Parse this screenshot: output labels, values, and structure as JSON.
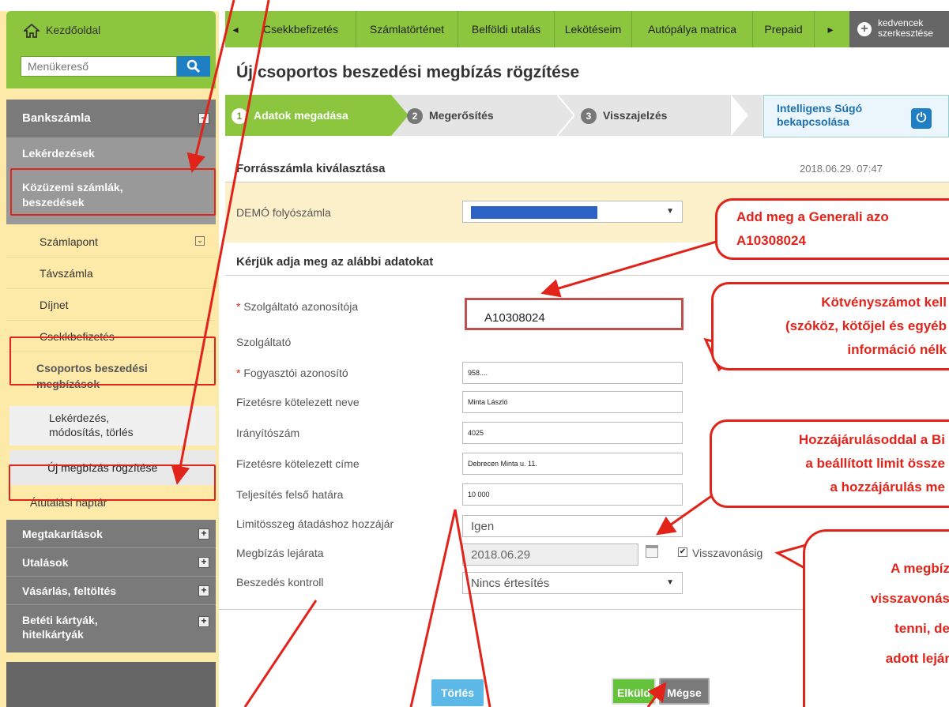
{
  "sidebar": {
    "home_label": "Kezdőoldal",
    "search_placeholder": "Menükereső",
    "account_section": "Bankszámla",
    "items": [
      {
        "label": "Lekérdezések"
      },
      {
        "label": "Közüzemi számlák, beszedések"
      },
      {
        "label": "Számlapont"
      },
      {
        "label": "Távszámla"
      },
      {
        "label": "Díjnet"
      },
      {
        "label": "Csekkbefizetés"
      },
      {
        "label": "Csoportos beszedési megbízások"
      },
      {
        "label": "Lekérdezés, módosítás, törlés"
      },
      {
        "label": "Új megbízás rögzítése"
      },
      {
        "label": "Átutalási naptár"
      }
    ],
    "sections": [
      {
        "label": "Megtakarítások"
      },
      {
        "label": "Utalások"
      },
      {
        "label": "Vásárlás, feltöltés"
      },
      {
        "label": "Betéti kártyák, hitelkártyák"
      }
    ]
  },
  "topnav": {
    "items": [
      "Csekkbefizetés",
      "Számlatörténet",
      "Belföldi utalás",
      "Lekötéseim",
      "Autópálya matrica",
      "Prepaid"
    ],
    "favorites_label_1": "kedvencek",
    "favorites_label_2": "szerkesztése"
  },
  "page_title": "Új csoportos beszedési megbízás rögzítése",
  "steps": [
    {
      "num": "1",
      "label": "Adatok megadása"
    },
    {
      "num": "2",
      "label": "Megerősítés"
    },
    {
      "num": "3",
      "label": "Visszajelzés"
    }
  ],
  "help": {
    "line1": "Intelligens Súgó",
    "line2": "bekapcsolása"
  },
  "source_section": {
    "title": "Forrásszámla kiválasztása",
    "date": "2018.06.29. 07:47",
    "account_label": "DEMÓ folyószámla"
  },
  "form": {
    "section_title": "Kérjük adja meg az alábbi adatokat",
    "provider_id_label": "Szolgáltató azonosítója",
    "provider_id_value": "A10308024",
    "provider_label": "Szolgáltató",
    "consumer_id_label": "Fogyasztói azonosító",
    "consumer_id_value": "958....",
    "payer_name_label": "Fizetésre kötelezett neve",
    "payer_name_value": "Minta László",
    "zip_label": "Irányítószám",
    "zip_value": "4025",
    "payer_address_label": "Fizetésre kötelezett címe",
    "payer_address_value": "Debrecen Minta u. 11.",
    "limit_label": "Teljesítés felső határa",
    "limit_value": "10 000",
    "limit_consent_label": "Limitösszeg átadáshoz hozzájár",
    "limit_consent_value": "Igen",
    "expiry_label": "Megbízás lejárata",
    "expiry_value": "2018.06.29",
    "until_revoked_label": "Visszavonásig",
    "control_label": "Beszedés kontroll",
    "control_value": "Nincs értesítés"
  },
  "buttons": {
    "delete": "Törlés",
    "submit": "Elküld",
    "cancel": "Mégse"
  },
  "callouts": {
    "c1_line1": "Add meg a Generali azo",
    "c1_line2": "A10308024",
    "c2_line1": "Kötvényszámot kell",
    "c2_line2": "(szóköz, kötőjel és egyéb",
    "c2_line3": "információ nélk",
    "c3_line1": "Hozzájárulásoddal a Bi",
    "c3_line2": "a beállított limit össze",
    "c3_line3": "a hozzájárulás me",
    "c4_line1": "A megbíz",
    "c4_line2": "visszavonás",
    "c4_line3": "tenni, de",
    "c4_line4": "adott lejár"
  },
  "colors": {
    "green": "#8cc63f",
    "red": "#e2231a",
    "blue": "#1e7fc4",
    "gray": "#7a7a7a"
  }
}
